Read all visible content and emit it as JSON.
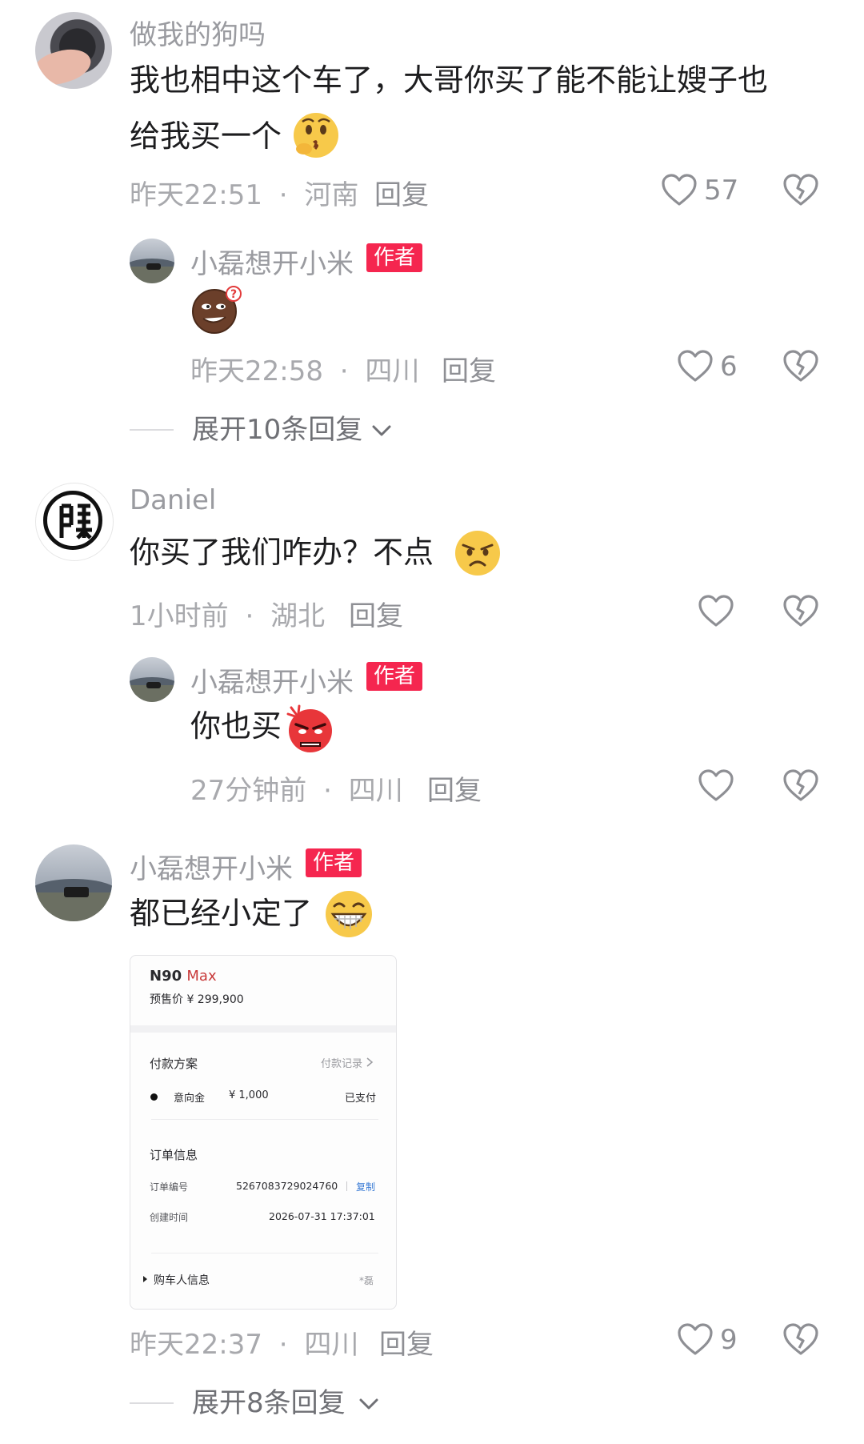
{
  "comments": [
    {
      "username": "做我的狗吗",
      "lines": [
        "我也相中这个车了，大哥你买了能不能让嫂子也",
        "给我买一个"
      ],
      "emoji": "kissing-face-emoji",
      "time": "昨天22:51",
      "location": "河南",
      "reply_label": "回复",
      "likes": "57",
      "replies": [
        {
          "username": "小磊想开小米",
          "badge": "作者",
          "emoji": "smirking-emoji",
          "time": "昨天22:58",
          "location": "四川",
          "reply_label": "回复",
          "likes": "6"
        }
      ],
      "expand_label": "展开10条回复"
    },
    {
      "username": "Daniel",
      "text": "你买了我们咋办？不点",
      "emoji": "frowning-face-emoji",
      "time": "1小时前",
      "location": "湖北",
      "reply_label": "回复",
      "replies": [
        {
          "username": "小磊想开小米",
          "badge": "作者",
          "text": "你也买",
          "emoji": "angry-face-emoji",
          "time": "27分钟前",
          "location": "四川",
          "reply_label": "回复"
        }
      ]
    },
    {
      "username": "小磊想开小米",
      "badge": "作者",
      "text": "都已经小定了",
      "emoji": "grinning-face-emoji",
      "card": {
        "model_prefix": "N90",
        "model_suffix": "Max",
        "presale": "预售价 ¥ 299,900",
        "payment_plan": "付款方案",
        "payment_record": "付款记录",
        "deposit_label": "意向金",
        "deposit_amount": "¥ 1,000",
        "deposit_status": "已支付",
        "order_info": "订单信息",
        "order_no_label": "订单编号",
        "order_no": "5267083729024760",
        "copy": "复制",
        "created_label": "创建时间",
        "created_time": "2026-07-31 17:37:01",
        "buyer_info": "购车人信息",
        "buyer_name": "*磊"
      },
      "time": "昨天22:37",
      "location": "四川",
      "reply_label": "回复",
      "likes": "9",
      "expand_label": "展开8条回复"
    }
  ],
  "separator": "·",
  "icons": [
    "heart-outline-icon",
    "broken-heart-icon",
    "chevron-down-icon"
  ],
  "colors": {
    "author_badge": "#f5264f",
    "text": "#1d1d1f",
    "meta": "#a8a9ad"
  }
}
